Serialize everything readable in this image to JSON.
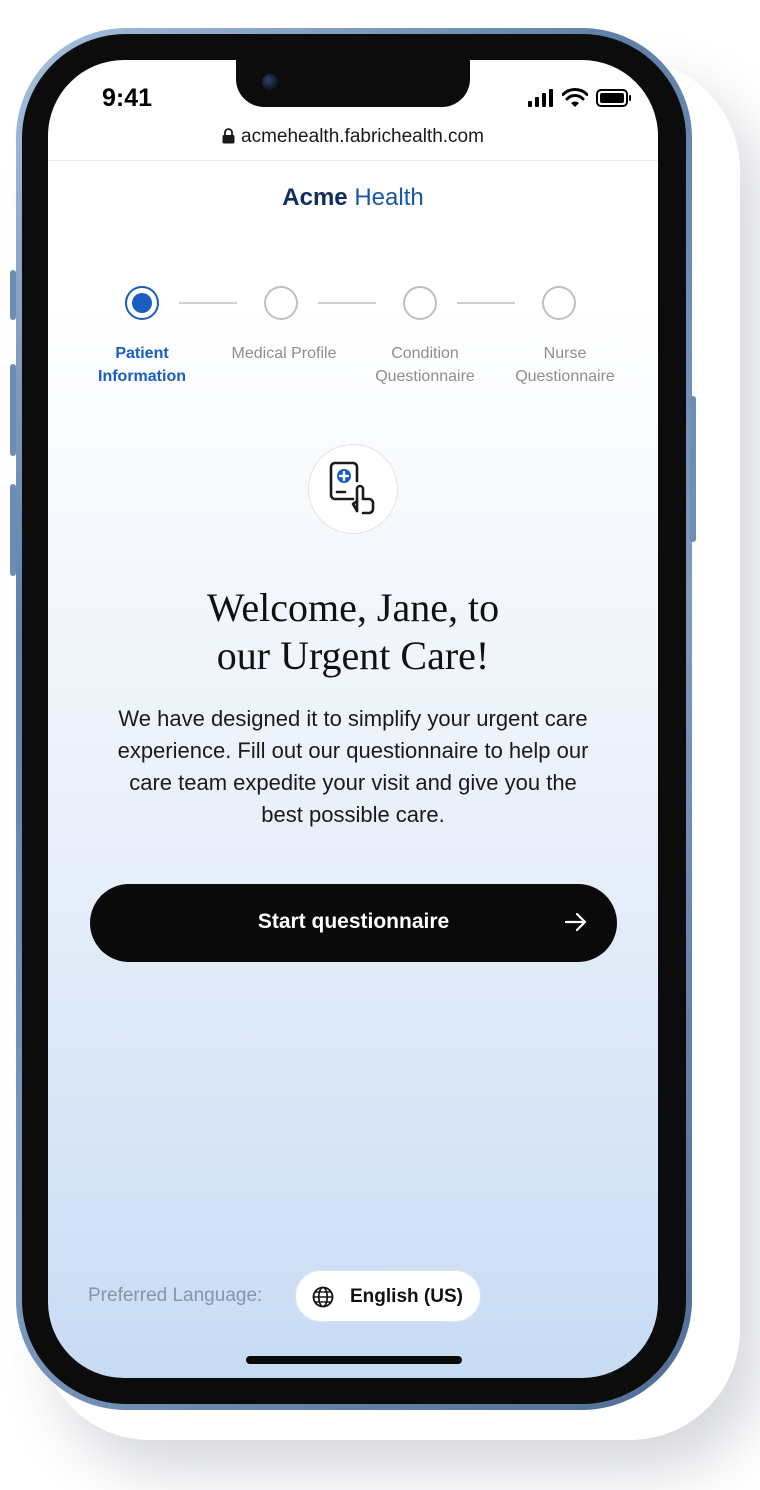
{
  "status_bar": {
    "time": "9:41"
  },
  "browser": {
    "url": "acmehealth.fabrichealth.com"
  },
  "brand": {
    "name_bold": "Acme",
    "name_regular": "Health"
  },
  "stepper": {
    "steps": [
      {
        "line1": "Patient",
        "line2": "Information",
        "active": true
      },
      {
        "line1": "Medical Profile",
        "line2": "",
        "active": false
      },
      {
        "line1": "Condition",
        "line2": "Questionnaire",
        "active": false
      },
      {
        "line1": "Nurse",
        "line2": "Questionnaire",
        "active": false
      }
    ]
  },
  "hero": {
    "icon": "phone-medical-tap-icon"
  },
  "welcome": {
    "line1": "Welcome, Jane, to",
    "line2": "our Urgent Care!"
  },
  "intro": {
    "line1": "We have designed it to simplify your urgent care",
    "line2": "experience. Fill out our questionnaire to help our",
    "line3": "care team expedite your visit and give you the",
    "line4": "best possible care."
  },
  "start_button": {
    "label": "Start questionnaire",
    "icon": "arrow-right-icon"
  },
  "language": {
    "label": "Preferred Language:",
    "value": "English (US)",
    "icon": "globe-icon"
  },
  "colors": {
    "accent": "#1a5cc2",
    "brand_dark": "#0f2d63",
    "button": "#0a0a0a"
  }
}
